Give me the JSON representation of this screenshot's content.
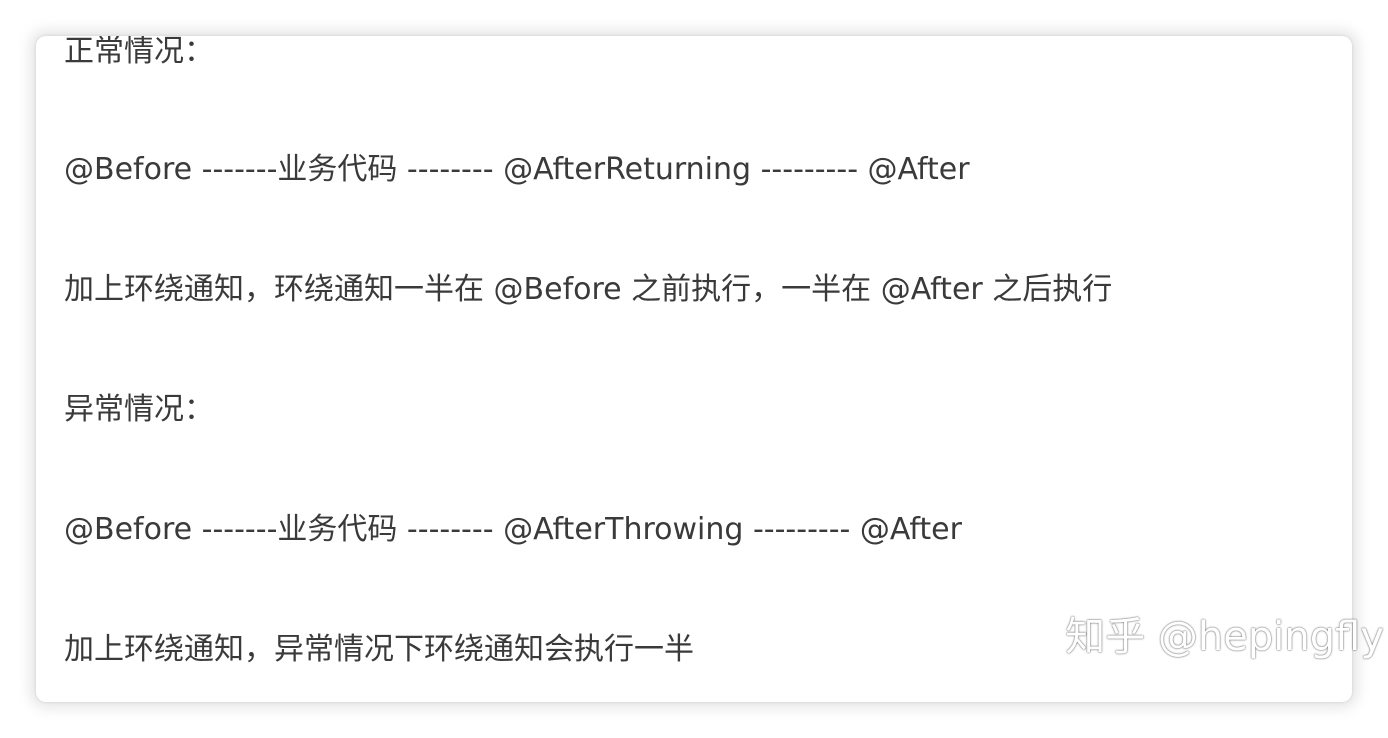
{
  "document": {
    "lines": [
      "正常情况：",
      "@Before -------业务代码 -------- @AfterReturning --------- @After",
      "加上环绕通知，环绕通知一半在 @Before 之前执行，一半在 @After 之后执行",
      "异常情况：",
      "@Before -------业务代码 -------- @AfterThrowing --------- @After",
      "加上环绕通知，异常情况下环绕通知会执行一半"
    ]
  },
  "watermark": "知乎 @hepingfly"
}
